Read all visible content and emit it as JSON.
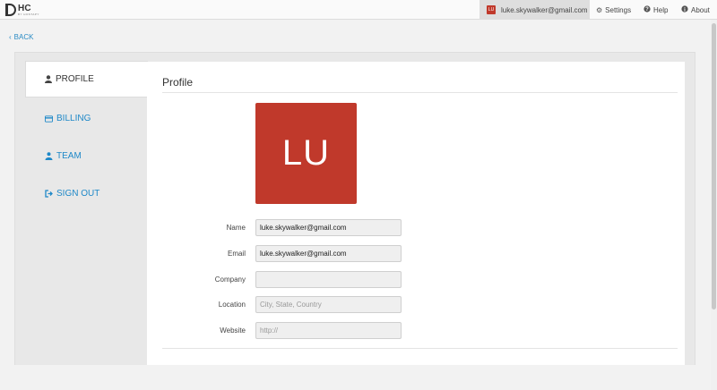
{
  "topbar": {
    "logo": {
      "text": "HC",
      "subtext": "BY HOSTAPY"
    },
    "user": {
      "avatar_initials": "LU",
      "email": "luke.skywalker@gmail.com"
    },
    "links": [
      {
        "label": "Settings",
        "icon": "gear-icon"
      },
      {
        "label": "Help",
        "icon": "question-circle-icon"
      },
      {
        "label": "About",
        "icon": "info-circle-icon"
      }
    ]
  },
  "back": {
    "label": "BACK",
    "icon": "chevron-left-icon"
  },
  "sidebar": {
    "items": [
      {
        "label": "PROFILE",
        "icon": "user-icon",
        "active": true
      },
      {
        "label": "BILLING",
        "icon": "credit-card-icon",
        "active": false
      },
      {
        "label": "TEAM",
        "icon": "team-icon",
        "active": false
      },
      {
        "label": "SIGN OUT",
        "icon": "sign-out-icon",
        "active": false
      }
    ]
  },
  "profile": {
    "title": "Profile",
    "avatar_initials": "LU",
    "avatar_color": "#c0392b",
    "fields": {
      "name": {
        "label": "Name",
        "value": "luke.skywalker@gmail.com",
        "placeholder": ""
      },
      "email": {
        "label": "Email",
        "value": "luke.skywalker@gmail.com",
        "placeholder": ""
      },
      "company": {
        "label": "Company",
        "value": "",
        "placeholder": ""
      },
      "location": {
        "label": "Location",
        "value": "",
        "placeholder": "City, State, Country"
      },
      "website": {
        "label": "Website",
        "value": "",
        "placeholder": "http://"
      }
    }
  },
  "colors": {
    "link": "#1e88c8",
    "accent": "#c0392b"
  }
}
